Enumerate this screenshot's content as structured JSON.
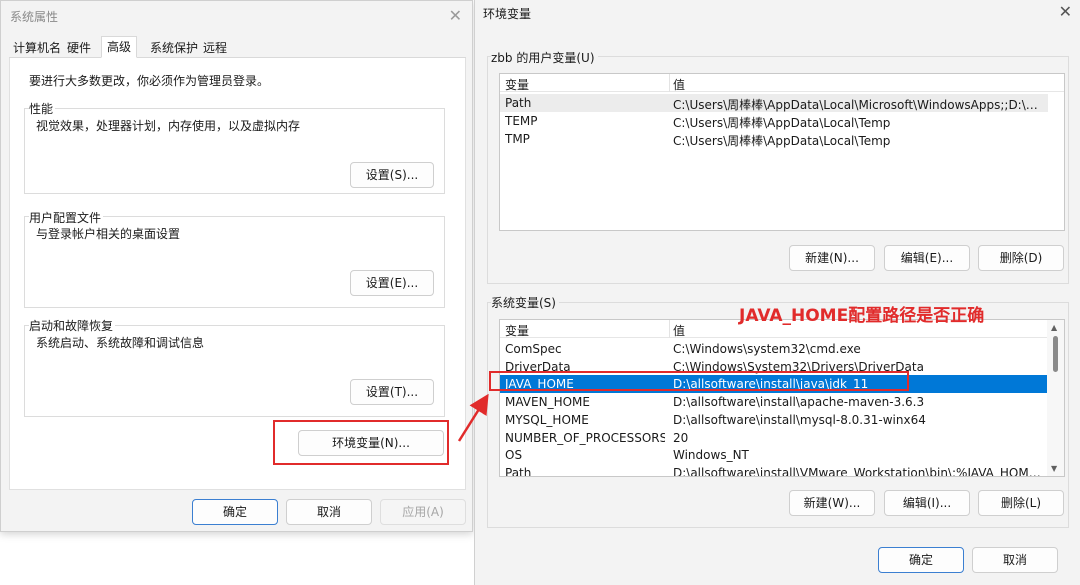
{
  "system_properties": {
    "title": "系统属性",
    "close_glyph": "✕",
    "tabs": [
      "计算机名",
      "硬件",
      "高级",
      "系统保护",
      "远程"
    ],
    "active_tab": "高级",
    "intro": "要进行大多数更改，你必须作为管理员登录。",
    "performance": {
      "label": "性能",
      "desc": "视觉效果，处理器计划，内存使用，以及虚拟内存",
      "button": "设置(S)..."
    },
    "user_profiles": {
      "label": "用户配置文件",
      "desc": "与登录帐户相关的桌面设置",
      "button": "设置(E)..."
    },
    "startup_recovery": {
      "label": "启动和故障恢复",
      "desc": "系统启动、系统故障和调试信息",
      "button": "设置(T)..."
    },
    "env_button": "环境变量(N)...",
    "footer": {
      "ok": "确定",
      "cancel": "取消",
      "apply": "应用(A)"
    }
  },
  "env_vars": {
    "title": "环境变量",
    "close_glyph": "✕",
    "user_section": {
      "label": "zbb 的用户变量(U)",
      "columns": [
        "变量",
        "值"
      ],
      "rows": [
        {
          "name": "Path",
          "value": "C:\\Users\\周棒棒\\AppData\\Local\\Microsoft\\WindowsApps;;D:\\allsoft..."
        },
        {
          "name": "TEMP",
          "value": "C:\\Users\\周棒棒\\AppData\\Local\\Temp"
        },
        {
          "name": "TMP",
          "value": "C:\\Users\\周棒棒\\AppData\\Local\\Temp"
        }
      ],
      "buttons": {
        "new": "新建(N)...",
        "edit": "编辑(E)...",
        "delete": "删除(D)"
      }
    },
    "system_section": {
      "label": "系统变量(S)",
      "columns": [
        "变量",
        "值"
      ],
      "rows": [
        {
          "name": "ComSpec",
          "value": "C:\\Windows\\system32\\cmd.exe"
        },
        {
          "name": "DriverData",
          "value": "C:\\Windows\\System32\\Drivers\\DriverData"
        },
        {
          "name": "JAVA_HOME",
          "value": "D:\\allsoftware\\install\\java\\jdk_11"
        },
        {
          "name": "MAVEN_HOME",
          "value": "D:\\allsoftware\\install\\apache-maven-3.6.3"
        },
        {
          "name": "MYSQL_HOME",
          "value": "D:\\allsoftware\\install\\mysql-8.0.31-winx64"
        },
        {
          "name": "NUMBER_OF_PROCESSORS",
          "value": "20"
        },
        {
          "name": "OS",
          "value": "Windows_NT"
        },
        {
          "name": "Path",
          "value": "D:\\allsoftware\\install\\VMware_Workstation\\bin\\;%JAVA_HOME%\\"
        }
      ],
      "selected_row": "JAVA_HOME",
      "buttons": {
        "new": "新建(W)...",
        "edit": "编辑(I)...",
        "delete": "删除(L)"
      }
    },
    "footer": {
      "ok": "确定",
      "cancel": "取消"
    }
  },
  "annotation": {
    "text": "JAVA_HOME配置路径是否正确",
    "color": "#e12b2b"
  },
  "colors": {
    "selection_blue": "#0078d7",
    "highlight_red": "#e12b2b"
  }
}
